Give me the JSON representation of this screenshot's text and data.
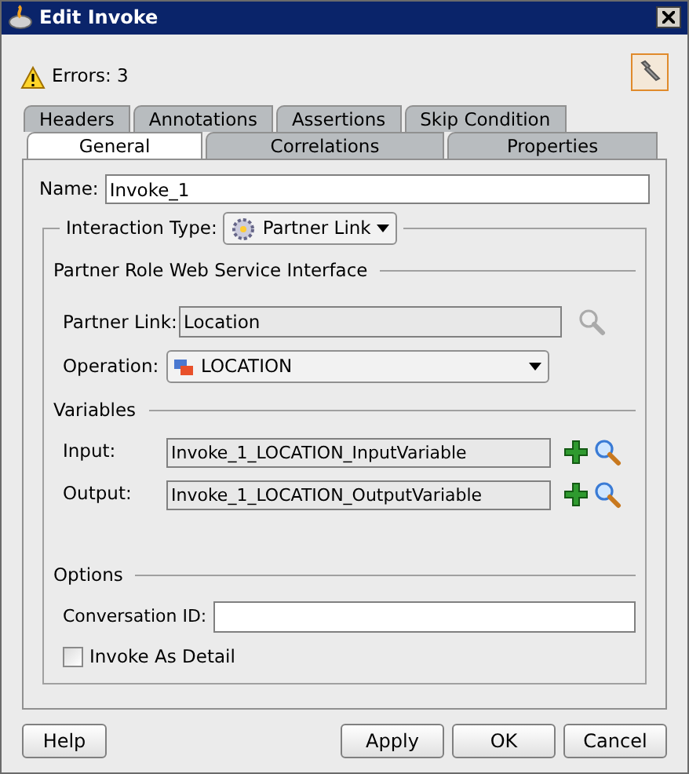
{
  "window": {
    "title": "Edit Invoke"
  },
  "errors": "Errors: 3",
  "tab_rows": [
    [
      {
        "label": "Headers",
        "selected": false
      },
      {
        "label": "Annotations",
        "selected": false
      },
      {
        "label": "Assertions",
        "selected": false
      },
      {
        "label": "Skip Condition",
        "selected": false
      }
    ],
    [
      {
        "label": "General",
        "selected": true
      },
      {
        "label": "Correlations",
        "selected": false
      },
      {
        "label": "Properties",
        "selected": false
      }
    ]
  ],
  "name": {
    "label": "Name:",
    "value": "Invoke_1"
  },
  "interaction_type": {
    "label": "Interaction Type:",
    "value": "Partner Link"
  },
  "partner_role": {
    "heading": "Partner Role Web Service Interface",
    "partner_link": {
      "label": "Partner Link:",
      "value": "Location"
    },
    "operation": {
      "label": "Operation:",
      "value": "LOCATION"
    }
  },
  "variables": {
    "heading": "Variables",
    "rows": [
      {
        "label": "Input:",
        "value": "Invoke_1_LOCATION_InputVariable"
      },
      {
        "label": "Output:",
        "value": "Invoke_1_LOCATION_OutputVariable"
      }
    ]
  },
  "options": {
    "heading": "Options",
    "conversation_id": {
      "label": "Conversation ID:"
    },
    "invoke_as_detail": {
      "label": "Invoke As Detail",
      "checked": false
    }
  },
  "buttons": {
    "help": "Help",
    "apply": "Apply",
    "ok": "OK",
    "cancel": "Cancel"
  }
}
